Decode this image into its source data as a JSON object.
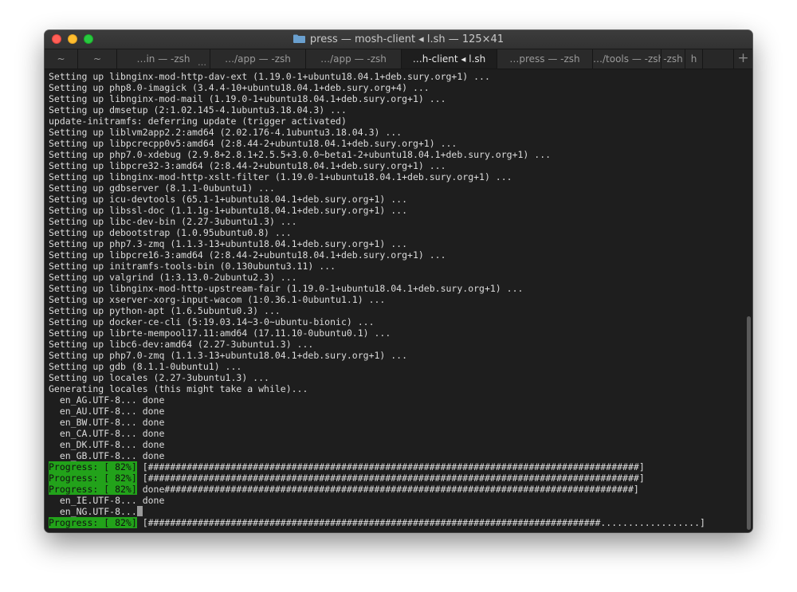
{
  "window": {
    "title": "press — mosh-client ◂ l.sh — 125×41",
    "folder_icon": "folder-icon"
  },
  "tabs": [
    {
      "label": "~",
      "width": 42
    },
    {
      "label": "~",
      "width": 49
    },
    {
      "label": "…in — -zsh",
      "width": 117
    },
    {
      "label": "…/app — -zsh",
      "width": 120
    },
    {
      "label": "…/app — -zsh",
      "width": 120
    },
    {
      "label": "…h-client ◂ l.sh",
      "width": 120,
      "active": true
    },
    {
      "label": "…press — -zsh",
      "width": 120
    },
    {
      "label": "…/tools — -zsh",
      "width": 86
    },
    {
      "label": "-zsh",
      "width": 30
    },
    {
      "label": "h",
      "width": 22
    }
  ],
  "new_tab_label": "+",
  "terminal": {
    "lines": [
      "Setting up libnginx-mod-http-dav-ext (1.19.0-1+ubuntu18.04.1+deb.sury.org+1) ...",
      "Setting up php8.0-imagick (3.4.4-10+ubuntu18.04.1+deb.sury.org+4) ...",
      "Setting up libnginx-mod-mail (1.19.0-1+ubuntu18.04.1+deb.sury.org+1) ...",
      "Setting up dmsetup (2:1.02.145-4.1ubuntu3.18.04.3) ...",
      "update-initramfs: deferring update (trigger activated)",
      "Setting up liblvm2app2.2:amd64 (2.02.176-4.1ubuntu3.18.04.3) ...",
      "Setting up libpcrecpp0v5:amd64 (2:8.44-2+ubuntu18.04.1+deb.sury.org+1) ...",
      "Setting up php7.0-xdebug (2.9.8+2.8.1+2.5.5+3.0.0~beta1-2+ubuntu18.04.1+deb.sury.org+1) ...",
      "Setting up libpcre32-3:amd64 (2:8.44-2+ubuntu18.04.1+deb.sury.org+1) ...",
      "Setting up libnginx-mod-http-xslt-filter (1.19.0-1+ubuntu18.04.1+deb.sury.org+1) ...",
      "Setting up gdbserver (8.1.1-0ubuntu1) ...",
      "Setting up icu-devtools (65.1-1+ubuntu18.04.1+deb.sury.org+1) ...",
      "Setting up libssl-doc (1.1.1g-1+ubuntu18.04.1+deb.sury.org+1) ...",
      "Setting up libc-dev-bin (2.27-3ubuntu1.3) ...",
      "Setting up debootstrap (1.0.95ubuntu0.8) ...",
      "Setting up php7.3-zmq (1.1.3-13+ubuntu18.04.1+deb.sury.org+1) ...",
      "Setting up libpcre16-3:amd64 (2:8.44-2+ubuntu18.04.1+deb.sury.org+1) ...",
      "Setting up initramfs-tools-bin (0.130ubuntu3.11) ...",
      "Setting up valgrind (1:3.13.0-2ubuntu2.3) ...",
      "Setting up libnginx-mod-http-upstream-fair (1.19.0-1+ubuntu18.04.1+deb.sury.org+1) ...",
      "Setting up xserver-xorg-input-wacom (1:0.36.1-0ubuntu1.1) ...",
      "Setting up python-apt (1.6.5ubuntu0.3) ...",
      "Setting up docker-ce-cli (5:19.03.14~3-0~ubuntu-bionic) ...",
      "Setting up librte-mempool17.11:amd64 (17.11.10-0ubuntu0.1) ...",
      "Setting up libc6-dev:amd64 (2.27-3ubuntu1.3) ...",
      "Setting up php7.0-zmq (1.1.3-13+ubuntu18.04.1+deb.sury.org+1) ...",
      "Setting up gdb (8.1.1-0ubuntu1) ...",
      "Setting up locales (2.27-3ubuntu1.3) ...",
      "Generating locales (this might take a while)...",
      "  en_AG.UTF-8... done",
      "  en_AU.UTF-8... done",
      "  en_BW.UTF-8... done",
      "  en_CA.UTF-8... done",
      "  en_DK.UTF-8... done",
      "  en_GB.UTF-8... done"
    ],
    "progress_label": "Progress: [ 82%]",
    "progress_bar_full": " [#########################################################################################]",
    "progress_bar_done": " done#####################################################################################]",
    "after_lines": [
      "  en_IE.UTF-8... done",
      "  en_NG.UTF-8..."
    ],
    "final_bar": " [##################################################################################..................]"
  },
  "colors": {
    "progress_green": "#22a21a",
    "terminal_bg": "#1e1e1e",
    "terminal_fg": "#dcdcdc"
  }
}
